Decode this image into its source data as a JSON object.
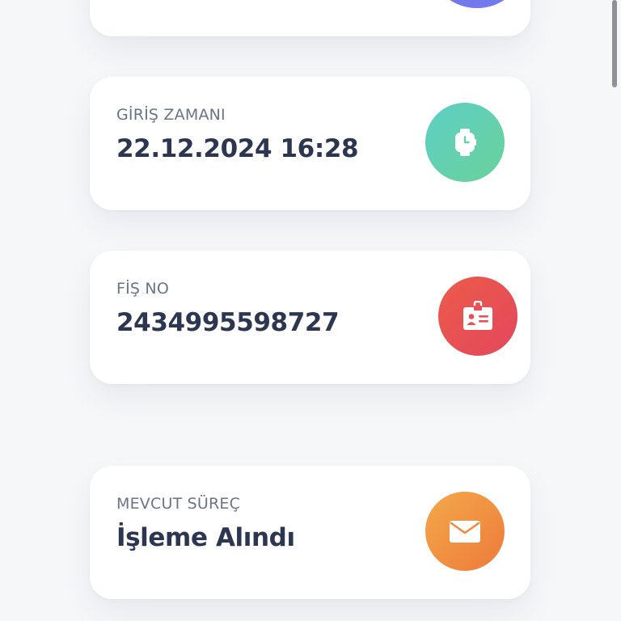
{
  "cards": [
    {
      "label": "GİRİŞ ZAMANI",
      "value": "22.12.2024 16:28",
      "icon": "watch-icon",
      "color_from": "#5dcfc6",
      "color_to": "#6ad19a"
    },
    {
      "label": "FİŞ NO",
      "value": "2434995598727",
      "icon": "id-badge-icon",
      "color_from": "#ec5b4a",
      "color_to": "#e3475c"
    },
    {
      "label": "MEVCUT SÜREÇ",
      "value": "İşleme Alındı",
      "icon": "envelope-icon",
      "color_from": "#f3a94a",
      "color_to": "#ee7a3b"
    }
  ],
  "colors": {
    "background": "#f6f7f9",
    "card": "#ffffff",
    "label_text": "#6b7486",
    "value_text": "#2c3650",
    "top_card_icon": "#7b6ce6"
  }
}
